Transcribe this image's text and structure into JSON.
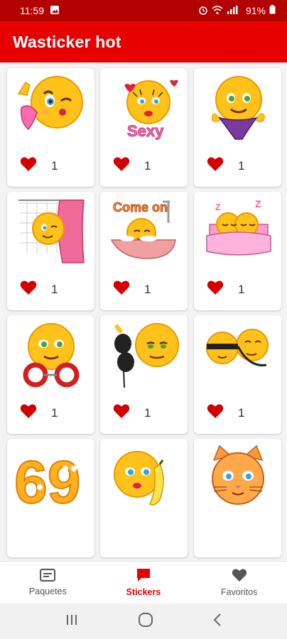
{
  "status_bar": {
    "time": "11:59",
    "battery": "91%"
  },
  "app_bar": {
    "title": "Wasticker hot"
  },
  "stickers": [
    {
      "likes": "1",
      "name": "wink-kiss"
    },
    {
      "likes": "1",
      "name": "sexy-kiss"
    },
    {
      "likes": "1",
      "name": "lingerie"
    },
    {
      "likes": "1",
      "name": "shower-curtain"
    },
    {
      "likes": "1",
      "name": "come-on-bathtub"
    },
    {
      "likes": "1",
      "name": "couple-in-bed"
    },
    {
      "likes": "1",
      "name": "handcuffs"
    },
    {
      "likes": "1",
      "name": "bra"
    },
    {
      "likes": "1",
      "name": "blindfold-couple"
    },
    {
      "likes": "",
      "name": "sixty-nine"
    },
    {
      "likes": "",
      "name": "banana"
    },
    {
      "likes": "",
      "name": "cat"
    }
  ],
  "bottom_nav": {
    "items": [
      {
        "label": "Paquetes",
        "icon": "packs-icon"
      },
      {
        "label": "Stickers",
        "icon": "stickers-icon"
      },
      {
        "label": "Favoritos",
        "icon": "heart-icon"
      }
    ],
    "active": "Stickers"
  },
  "colors": {
    "primary": "#e60000",
    "status": "#b30000",
    "heart": "#d40000"
  }
}
